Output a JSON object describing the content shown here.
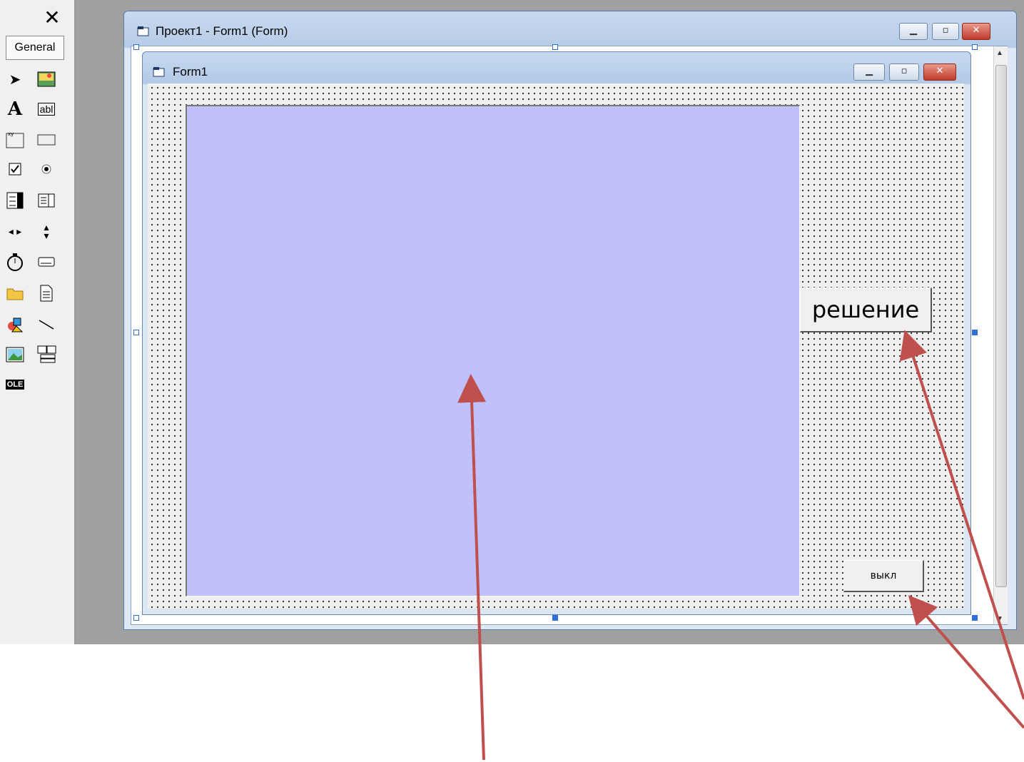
{
  "toolbox": {
    "close_glyph": "✕",
    "tab_label": "General",
    "tools": [
      "pointer-icon",
      "picturebox-icon",
      "label-icon",
      "textbox-icon",
      "frame-icon",
      "commandbutton-icon",
      "checkbox-icon",
      "optionbutton-icon",
      "combobox-icon",
      "listbox-icon",
      "hscrollbar-icon",
      "vscrollbar-icon",
      "timer-icon",
      "drivelistbox-icon",
      "dirlistbox-icon",
      "filelistbox-icon",
      "shape-icon",
      "line-icon",
      "image-icon",
      "data-icon",
      "ole-icon"
    ],
    "label_glyph": "A",
    "textbox_glyph": "abl",
    "ole_glyph": "OLE"
  },
  "project_window": {
    "title": "Проект1 - Form1 (Form)"
  },
  "form1": {
    "title": "Form1",
    "picture_color": "#c0c0fc",
    "buttons": {
      "solve_label": "решение",
      "off_label": "выкл"
    }
  },
  "colors": {
    "arrow": "#c0504d",
    "designer_bg": "#a0a0a0",
    "handle": "#2f6fd8"
  }
}
